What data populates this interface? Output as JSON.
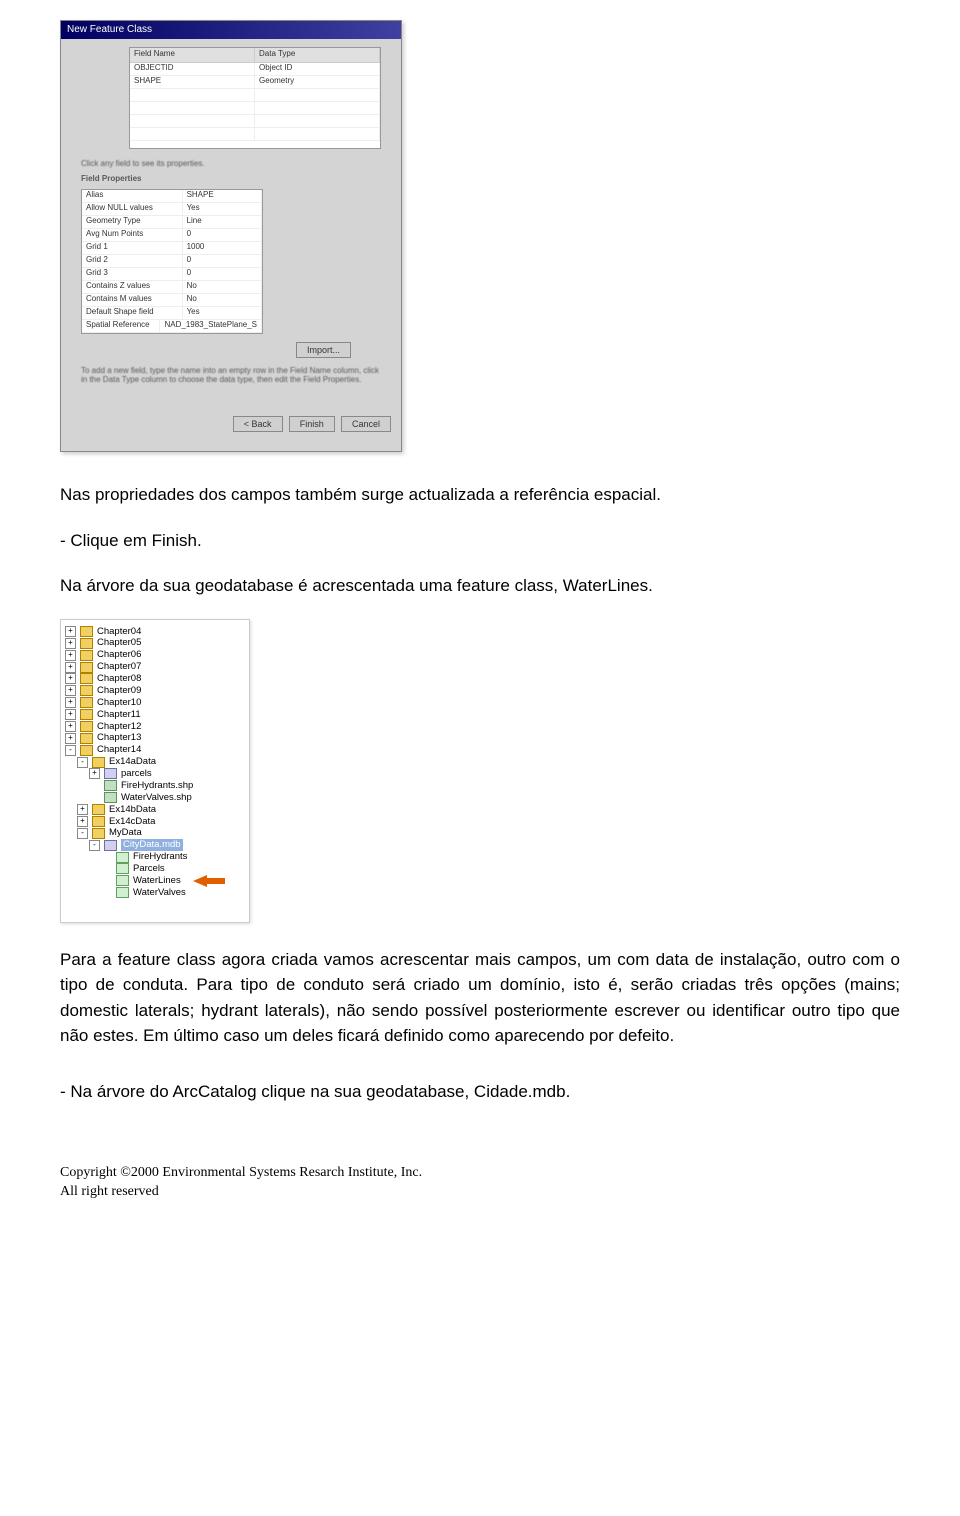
{
  "dialog": {
    "title": "New Feature Class",
    "fields_table": {
      "headers": [
        "Field Name",
        "Data Type"
      ],
      "rows": [
        [
          "OBJECTID",
          "Object ID"
        ],
        [
          "SHAPE",
          "Geometry"
        ]
      ],
      "empty_rows": 4
    },
    "hint": "Click any field to see its properties.",
    "props_label": "Field Properties",
    "props": [
      [
        "Alias",
        "SHAPE"
      ],
      [
        "Allow NULL values",
        "Yes"
      ],
      [
        "Geometry Type",
        "Line"
      ],
      [
        "Avg Num Points",
        "0"
      ],
      [
        "Grid 1",
        "1000"
      ],
      [
        "Grid 2",
        "0"
      ],
      [
        "Grid 3",
        "0"
      ],
      [
        "Contains Z values",
        "No"
      ],
      [
        "Contains M values",
        "No"
      ],
      [
        "Default Shape field",
        "Yes"
      ],
      [
        "Spatial Reference",
        "NAD_1983_StatePlane_S"
      ]
    ],
    "import_btn": "Import...",
    "tip": "To add a new field, type the name into an empty row in the Field Name column, click in the Data Type column to choose the data type, then edit the Field Properties.",
    "back_btn": "< Back",
    "finish_btn": "Finish",
    "cancel_btn": "Cancel"
  },
  "text1": "Nas propriedades dos campos também surge actualizada a referência espacial.",
  "text2": "- Clique em Finish.",
  "text3": "Na árvore da sua geodatabase é acrescentada uma feature class, WaterLines.",
  "tree": {
    "items": [
      {
        "indent": 0,
        "toggle": "+",
        "icon": "folder",
        "label": "Chapter04"
      },
      {
        "indent": 0,
        "toggle": "+",
        "icon": "folder",
        "label": "Chapter05"
      },
      {
        "indent": 0,
        "toggle": "+",
        "icon": "folder",
        "label": "Chapter06"
      },
      {
        "indent": 0,
        "toggle": "+",
        "icon": "folder",
        "label": "Chapter07"
      },
      {
        "indent": 0,
        "toggle": "+",
        "icon": "folder",
        "label": "Chapter08"
      },
      {
        "indent": 0,
        "toggle": "+",
        "icon": "folder",
        "label": "Chapter09"
      },
      {
        "indent": 0,
        "toggle": "+",
        "icon": "folder",
        "label": "Chapter10"
      },
      {
        "indent": 0,
        "toggle": "+",
        "icon": "folder",
        "label": "Chapter11"
      },
      {
        "indent": 0,
        "toggle": "+",
        "icon": "folder",
        "label": "Chapter12"
      },
      {
        "indent": 0,
        "toggle": "+",
        "icon": "folder",
        "label": "Chapter13"
      },
      {
        "indent": 0,
        "toggle": "-",
        "icon": "folder",
        "label": "Chapter14"
      },
      {
        "indent": 1,
        "toggle": "-",
        "icon": "folder",
        "label": "Ex14aData"
      },
      {
        "indent": 2,
        "toggle": "+",
        "icon": "gdb",
        "label": "parcels"
      },
      {
        "indent": 2,
        "toggle": "",
        "icon": "shp",
        "label": "FireHydrants.shp"
      },
      {
        "indent": 2,
        "toggle": "",
        "icon": "shp",
        "label": "WaterValves.shp"
      },
      {
        "indent": 1,
        "toggle": "+",
        "icon": "folder",
        "label": "Ex14bData"
      },
      {
        "indent": 1,
        "toggle": "+",
        "icon": "folder",
        "label": "Ex14cData"
      },
      {
        "indent": 1,
        "toggle": "-",
        "icon": "folder",
        "label": "MyData"
      },
      {
        "indent": 2,
        "toggle": "-",
        "icon": "gdb",
        "label": "CityData.mdb",
        "hl": true
      },
      {
        "indent": 3,
        "toggle": "",
        "icon": "fc",
        "label": "FireHydrants"
      },
      {
        "indent": 3,
        "toggle": "",
        "icon": "fc",
        "label": "Parcels"
      },
      {
        "indent": 3,
        "toggle": "",
        "icon": "fc",
        "label": "WaterLines",
        "arrow": true
      },
      {
        "indent": 3,
        "toggle": "",
        "icon": "fc",
        "label": "WaterValves"
      }
    ]
  },
  "text4": "Para a feature class agora criada vamos acrescentar mais campos, um com data de instalação, outro com o tipo de conduta. Para tipo de conduto será criado um domínio, isto é, serão criadas três opções (mains; domestic laterals; hydrant laterals), não sendo possível posteriormente escrever ou identificar outro tipo que não estes. Em último caso um deles ficará definido como aparecendo por defeito.",
  "text5": "- Na árvore do ArcCatalog clique na sua geodatabase, Cidade.mdb.",
  "footer": {
    "line1": "Copyright ©2000 Environmental Systems Resarch Institute, Inc.",
    "line2": "All right reserved"
  }
}
